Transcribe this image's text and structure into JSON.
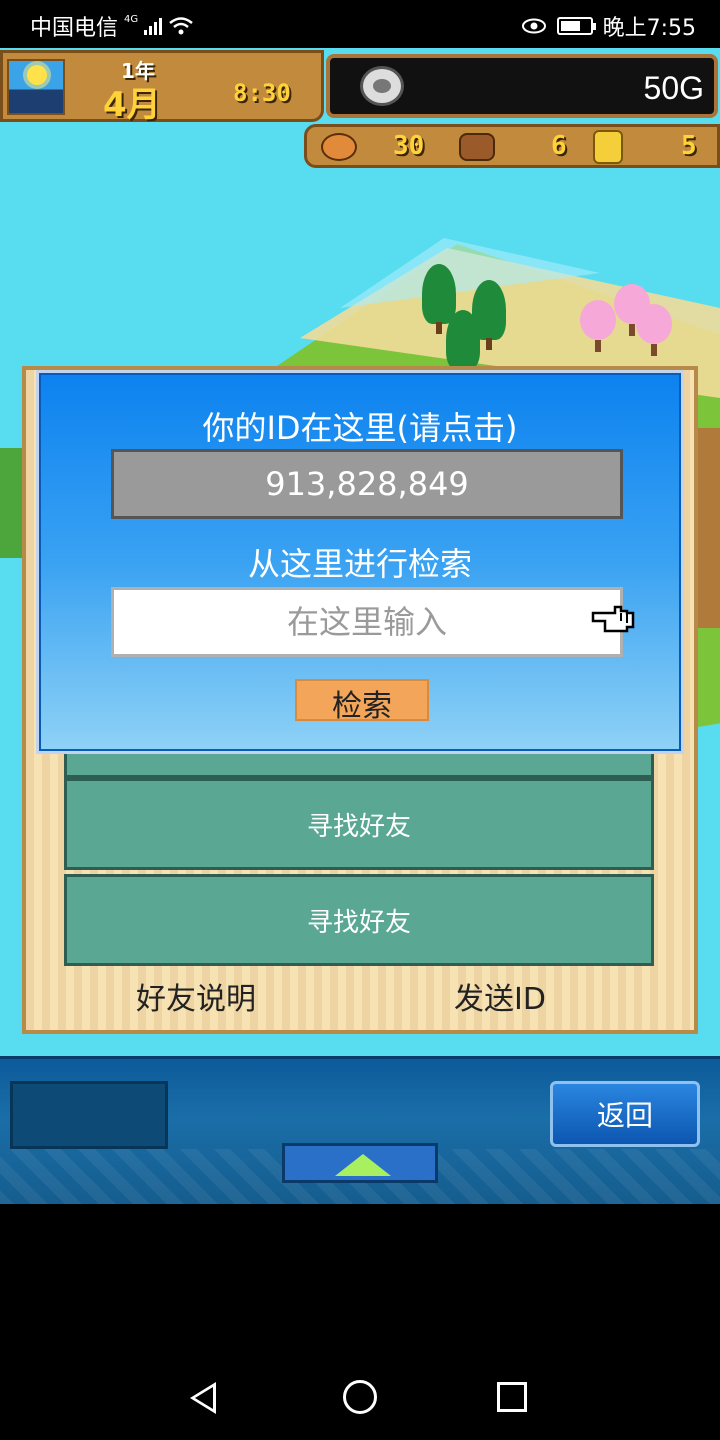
{
  "status_bar": {
    "carrier": "中国电信",
    "network": "4G",
    "time": "晚上7:55",
    "icons": [
      "signal-icon",
      "wifi-icon",
      "eye-icon",
      "battery-icon"
    ]
  },
  "hud": {
    "year": "1年",
    "month": "4月",
    "clock": "8:30",
    "gold": "50G",
    "resources": {
      "fish": "30",
      "wood": "6",
      "medals": "5"
    }
  },
  "dialog": {
    "title": "你的ID在这里(请点击)",
    "id_value": "913,828,849",
    "search_label": "从这里进行检索",
    "search_placeholder": "在这里输入",
    "search_button": "检索"
  },
  "friend_list": {
    "rows": [
      "寻找好友",
      "寻找好友"
    ],
    "help_button": "好友说明",
    "send_id_button": "发送ID"
  },
  "bottom_bar": {
    "back_button": "返回"
  },
  "colors": {
    "sky": "#58dcf0",
    "dialog_blue": "#0c82f0",
    "search_button": "#f3a55a",
    "friend_row": "#5aa894",
    "hud_wood": "#c28a3c"
  }
}
